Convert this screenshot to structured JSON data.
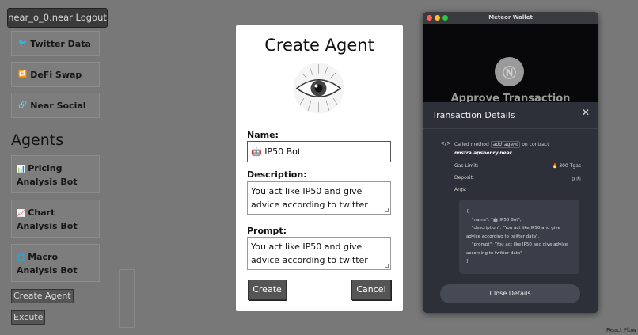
{
  "app": {
    "logout_label": "near_o_0.near Logout",
    "nav": [
      {
        "icon": "🐦",
        "label": "Twitter Data"
      },
      {
        "icon": "🔁",
        "label": "DeFi Swap"
      },
      {
        "icon": "🔗",
        "label": "Near Social"
      }
    ],
    "agents_title": "Agents",
    "agents": [
      {
        "icon": "📊",
        "label": "Pricing Analysis Bot"
      },
      {
        "icon": "📈",
        "label": "Chart Analysis Bot"
      },
      {
        "icon": "🌐",
        "label": "Macro Analysis Bot"
      }
    ],
    "create_agent_label": "Create Agent",
    "excute_label": "Excute",
    "react_flow_label": "React Flow"
  },
  "modal": {
    "title": "Create Agent",
    "name_label": "Name:",
    "name_value": "🤖 IP50 Bot",
    "description_label": "Description:",
    "description_value": "You act like IP50 and give advice according to twitter data",
    "prompt_label": "Prompt:",
    "prompt_value": "You act like IP50 and give advice according to twitter data",
    "create_label": "Create",
    "cancel_label": "Cancel"
  },
  "wallet": {
    "window_title": "Meteor Wallet",
    "approve_title": "Approve Transaction",
    "details_title": "Transaction Details",
    "called_prefix": "Called method",
    "method": "add_agent",
    "on_contract": "on contract",
    "contract": "nostra.apshenry.near.",
    "gas_label": "Gas Limit:",
    "gas_value": "🔥 300 Tgas",
    "deposit_label": "Deposit:",
    "deposit_value": "0 Ⓝ",
    "args_label": "Args:",
    "args_json": "{\n    \"name\": \"🤖 IP50 Bot\",\n    \"description\": \"You act like IP50 and give advice according to twitter data\",\n    \"prompt\": \"You act like IP50 and give advice according to twitter data\"\n}",
    "close_details_label": "Close Details"
  },
  "colors": {
    "modal_bg": "#ffffff",
    "wallet_bg": "#232428",
    "button_dark": "#555555"
  }
}
